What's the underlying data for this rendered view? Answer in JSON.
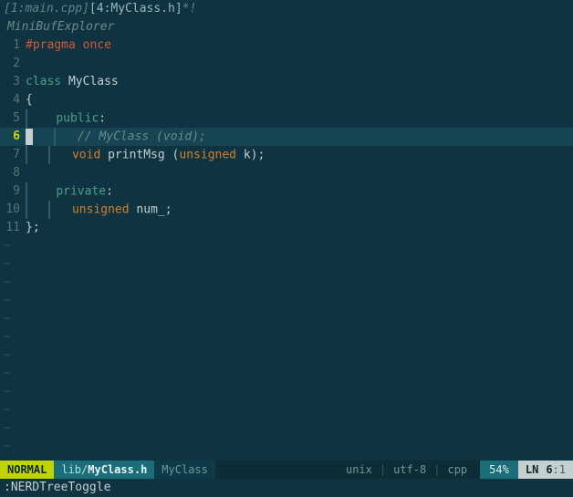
{
  "tabs": {
    "inactive": "[1:main.cpp]",
    "active": "[4:MyClass.h]",
    "modified_marker": "*!"
  },
  "minibuf_title": "MiniBufExplorer",
  "cursor_line": 6,
  "code": {
    "l1": {
      "num": "1",
      "pragma": "#pragma",
      "once": " once"
    },
    "l2": {
      "num": "2"
    },
    "l3": {
      "num": "3",
      "kw": "class",
      "sp": " ",
      "name": "MyClass"
    },
    "l4": {
      "num": "4",
      "brace": "{"
    },
    "l5": {
      "num": "5",
      "indent": "    ",
      "access": "public",
      "colon": ":"
    },
    "l6": {
      "num": "6",
      "indent": "        ",
      "comment": "// MyClass (void);"
    },
    "l7": {
      "num": "7",
      "indent": "        ",
      "type": "void",
      "sp": " ",
      "fn": "printMsg",
      "sp2": " (",
      "argtype": "unsigned",
      "sp3": " ",
      "arg": "k",
      "close": ");"
    },
    "l8": {
      "num": "8"
    },
    "l9": {
      "num": "9",
      "indent": "    ",
      "access": "private",
      "colon": ":"
    },
    "l10": {
      "num": "10",
      "indent": "        ",
      "type": "unsigned",
      "sp": " ",
      "name": "num_",
      "semi": ";"
    },
    "l11": {
      "num": "11",
      "brace": "};"
    }
  },
  "empty_marker": "~",
  "empty_count": 12,
  "statusline": {
    "mode": "NORMAL",
    "file_dir": "lib/",
    "file_name": "MyClass.h",
    "tag": "MyClass",
    "format": "unix",
    "encoding": "utf-8",
    "filetype": "cpp",
    "percent": "54%",
    "ln_label": "LN",
    "line": "6",
    "col": ":1"
  },
  "commandline": ":NERDTreeToggle"
}
